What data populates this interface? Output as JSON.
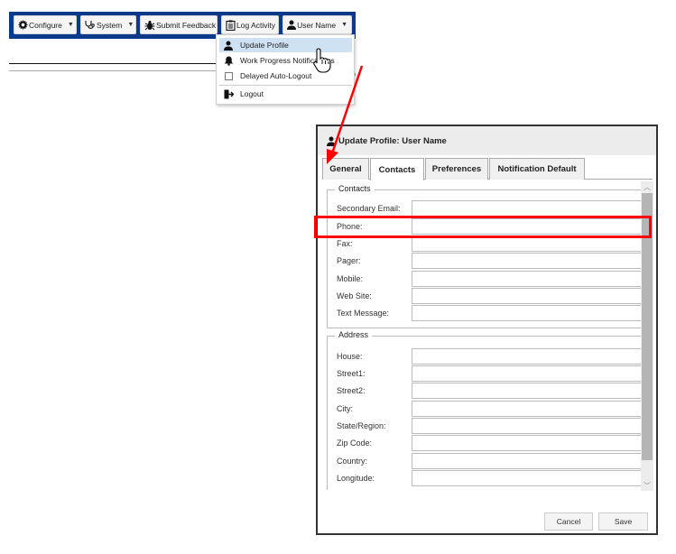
{
  "navbar": {
    "color": "#0b3a8c",
    "buttons": [
      {
        "label": "Configure",
        "icon": "gear-icon",
        "has_caret": true
      },
      {
        "label": "System",
        "icon": "stethoscope-icon",
        "has_caret": true
      },
      {
        "label": "Submit Feedback",
        "icon": "bug-icon",
        "has_caret": false
      },
      {
        "label": "Log Activity",
        "icon": "clipboard-icon",
        "has_caret": false
      },
      {
        "label": "User Name",
        "icon": "user-icon",
        "has_caret": true
      }
    ]
  },
  "user_menu": {
    "items": [
      {
        "label": "Update Profile",
        "icon": "user-icon",
        "active": true
      },
      {
        "label": "Work Progress Notifications",
        "icon": "bell-icon"
      },
      {
        "label": "Delayed Auto-Logout",
        "icon": "checkbox",
        "checked": false
      },
      {
        "label": "Logout",
        "icon": "logout-icon"
      }
    ]
  },
  "dialog": {
    "title": "Update Profile: User Name",
    "tabs": [
      {
        "label": "General",
        "active": false
      },
      {
        "label": "Contacts",
        "active": true
      },
      {
        "label": "Preferences",
        "active": false
      },
      {
        "label": "Notification Default",
        "active": false
      }
    ],
    "sections": [
      {
        "legend": "Contacts",
        "fields": [
          {
            "label": "Secondary Email:",
            "value": ""
          },
          {
            "label": "Phone:",
            "value": "",
            "highlighted": true
          },
          {
            "label": "Fax:",
            "value": ""
          },
          {
            "label": "Pager:",
            "value": ""
          },
          {
            "label": "Mobile:",
            "value": ""
          },
          {
            "label": "Web Site:",
            "value": ""
          },
          {
            "label": "Text Message:",
            "value": ""
          }
        ]
      },
      {
        "legend": "Address",
        "fields": [
          {
            "label": "House:",
            "value": ""
          },
          {
            "label": "Street1:",
            "value": ""
          },
          {
            "label": "Street2:",
            "value": ""
          },
          {
            "label": "City:",
            "value": ""
          },
          {
            "label": "State/Region:",
            "value": ""
          },
          {
            "label": "Zip Code:",
            "value": ""
          },
          {
            "label": "Country:",
            "value": ""
          },
          {
            "label": "Longitude:",
            "value": ""
          }
        ]
      }
    ],
    "buttons": {
      "cancel": "Cancel",
      "save": "Save"
    }
  },
  "annotation": {
    "highlight_color": "#ff0000",
    "arrow_color": "#ff0000"
  }
}
